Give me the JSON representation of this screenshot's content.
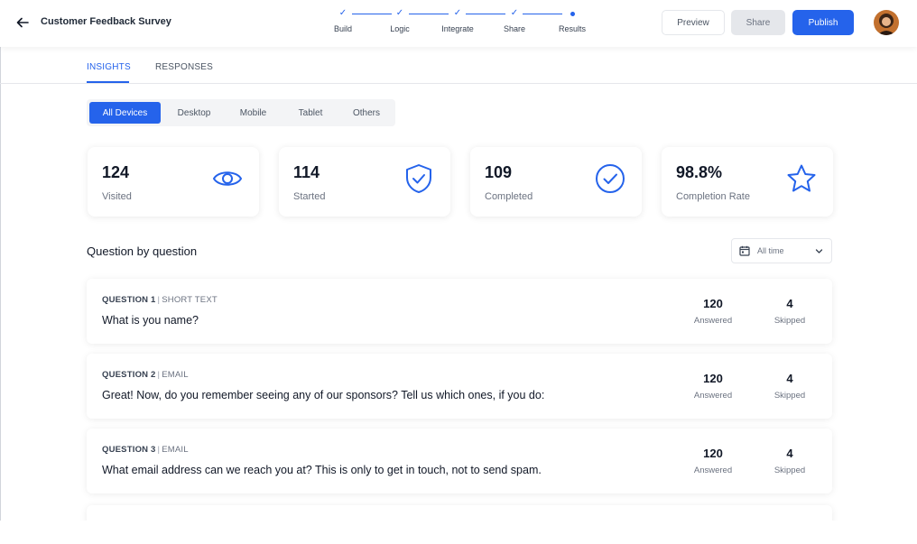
{
  "header": {
    "title": "Customer Feedback Survey",
    "steps": [
      {
        "label": "Build",
        "state": "done"
      },
      {
        "label": "Logic",
        "state": "done"
      },
      {
        "label": "Integrate",
        "state": "done"
      },
      {
        "label": "Share",
        "state": "done"
      },
      {
        "label": "Results",
        "state": "current"
      }
    ],
    "preview_label": "Preview",
    "share_label": "Share",
    "publish_label": "Publish"
  },
  "tabs": {
    "insights": "INSIGHTS",
    "responses": "RESPONSES"
  },
  "devices": [
    "All Devices",
    "Desktop",
    "Mobile",
    "Tablet",
    "Others"
  ],
  "stats": [
    {
      "value": "124",
      "label": "Visited",
      "icon": "eye-icon"
    },
    {
      "value": "114",
      "label": "Started",
      "icon": "shield-check-icon"
    },
    {
      "value": "109",
      "label": "Completed",
      "icon": "check-circle-icon"
    },
    {
      "value": "98.8%",
      "label": "Completion Rate",
      "icon": "star-icon"
    }
  ],
  "section": {
    "title": "Question by question",
    "time_filter": "All time"
  },
  "questions": [
    {
      "number": "QUESTION 1",
      "type": "SHORT TEXT",
      "text": "What is you name?",
      "answered": "120",
      "skipped": "4"
    },
    {
      "number": "QUESTION 2",
      "type": "EMAIL",
      "text": "Great! Now, do you remember seeing any of our sponsors? Tell us which ones, if you do:",
      "answered": "120",
      "skipped": "4"
    },
    {
      "number": "QUESTION 3",
      "type": "EMAIL",
      "text": "What email address can we reach you at? This is only to get in touch, not to send spam.",
      "answered": "120",
      "skipped": "4"
    }
  ],
  "labels": {
    "answered": "Answered",
    "skipped": "Skipped",
    "separator": "|"
  },
  "colors": {
    "accent": "#2563eb",
    "text_dark": "#111827",
    "text_muted": "#6b7280"
  }
}
